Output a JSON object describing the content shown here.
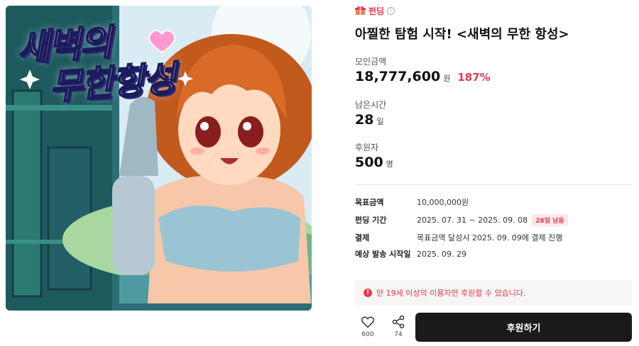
{
  "artwork": {
    "title_line1": "새벽의",
    "title_line2": "무한항성"
  },
  "badge": {
    "label": "펀딩",
    "icon": "gift-icon"
  },
  "title": "아찔한 탐험 시작! <새벽의 무한 항성>",
  "stats": {
    "amount": {
      "label": "모인금액",
      "value": "18,777,600",
      "unit": "원",
      "percent": "187%"
    },
    "time": {
      "label": "남은시간",
      "value": "28",
      "unit": "일"
    },
    "backers": {
      "label": "후원자",
      "value": "500",
      "unit": "명"
    }
  },
  "details": {
    "goal": {
      "label": "목표금액",
      "value": "10,000,000원"
    },
    "period": {
      "label": "펀딩 기간",
      "value": "2025. 07. 31 ~ 2025. 09. 08",
      "chip": "28일 남음"
    },
    "payment": {
      "label": "결제",
      "value": "목표금액 달성시 2025. 09. 09에 결제 진행"
    },
    "shipping": {
      "label": "예상 발송 시작일",
      "value": "2025. 09. 29"
    }
  },
  "notice": "만 19세 이상의 이용자만 후원할 수 있습니다.",
  "actions": {
    "like_count": "600",
    "share_count": "74",
    "support_label": "후원하기"
  },
  "colors": {
    "accent": "#e8394d",
    "button": "#1a1a1a"
  }
}
